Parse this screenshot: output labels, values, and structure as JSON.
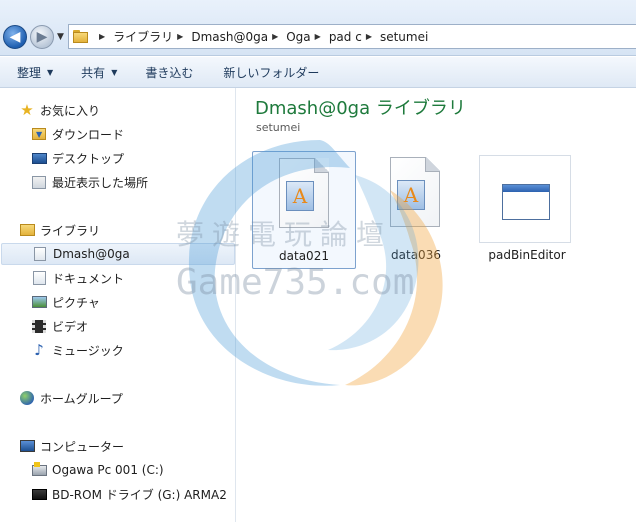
{
  "breadcrumb": {
    "items": [
      "ライブラリ",
      "Dmash@0ga",
      "Oga",
      "pad c",
      "setumei"
    ]
  },
  "toolbar": {
    "organize_label": "整理",
    "share_label": "共有",
    "burn_label": "書き込む",
    "new_folder_label": "新しいフォルダー"
  },
  "nav": {
    "favorites": {
      "label": "お気に入り",
      "items": [
        "ダウンロード",
        "デスクトップ",
        "最近表示した場所"
      ]
    },
    "libraries": {
      "label": "ライブラリ",
      "items": [
        "Dmash@0ga",
        "ドキュメント",
        "ピクチャ",
        "ビデオ",
        "ミュージック"
      ]
    },
    "homegroup": {
      "label": "ホームグループ"
    },
    "computer": {
      "label": "コンピューター",
      "items": [
        "Ogawa Pc 001 (C:)",
        "BD-ROM ドライブ (G:) ARMA2"
      ]
    }
  },
  "content": {
    "title": "Dmash@0ga ライブラリ",
    "subtitle": "setumei",
    "files": [
      {
        "name": "data021",
        "icon": "text-document-icon"
      },
      {
        "name": "data036",
        "icon": "text-document-icon"
      },
      {
        "name": "padBinEditor",
        "icon": "application-window-icon"
      }
    ]
  },
  "watermark": {
    "text": "夢遊電玩論壇",
    "domain": "Game735.com"
  },
  "colors": {
    "title_green": "#1e7a3c",
    "accent_blue": "#1f5fb0",
    "watermark_blue": "#4a9ad8",
    "watermark_orange": "#f2a23a"
  }
}
